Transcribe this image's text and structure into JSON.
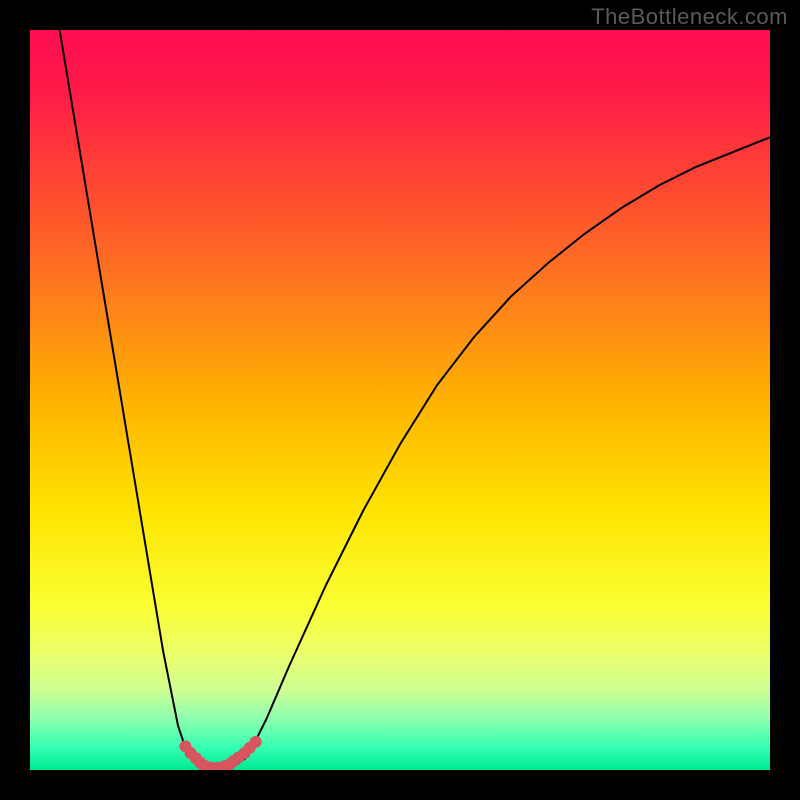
{
  "watermark": "TheBottleneck.com",
  "chart_data": {
    "type": "line",
    "title": "",
    "xlabel": "",
    "ylabel": "",
    "xlim": [
      0,
      100
    ],
    "ylim": [
      0,
      100
    ],
    "series": [
      {
        "name": "left-branch",
        "x": [
          4,
          6,
          8,
          10,
          12,
          14,
          16,
          18,
          20,
          21,
          22,
          23,
          23.5
        ],
        "y": [
          100,
          88,
          76,
          64,
          52,
          40,
          28,
          16,
          6,
          3,
          1.5,
          0.8,
          0.5
        ],
        "color": "#000000",
        "stroke_width": 2
      },
      {
        "name": "right-branch",
        "x": [
          27.5,
          28,
          29,
          30,
          32,
          35,
          40,
          45,
          50,
          55,
          60,
          65,
          70,
          75,
          80,
          85,
          90,
          95,
          100
        ],
        "y": [
          0.5,
          0.8,
          1.5,
          3,
          7,
          14,
          25,
          35,
          44,
          52,
          58.5,
          64,
          68.5,
          72.5,
          76,
          79,
          81.5,
          83.5,
          85.5
        ],
        "color": "#000000",
        "stroke_width": 2
      },
      {
        "name": "dotted-highlight",
        "x": [
          21,
          21.7,
          22.4,
          23,
          23.5,
          24.2,
          25,
          25.5,
          26.3,
          27,
          27.5,
          28.2,
          29,
          29.7,
          30.5
        ],
        "y": [
          3.2,
          2.3,
          1.6,
          1.0,
          0.6,
          0.35,
          0.25,
          0.3,
          0.5,
          0.8,
          1.2,
          1.7,
          2.3,
          3.0,
          3.8
        ],
        "color": "#d8545f",
        "marker": "circle",
        "marker_size": 6
      }
    ],
    "gradient": {
      "stops": [
        {
          "offset": 0,
          "color": "#ff0d52"
        },
        {
          "offset": 8,
          "color": "#ff1a48"
        },
        {
          "offset": 20,
          "color": "#ff4433"
        },
        {
          "offset": 35,
          "color": "#ff7a1f"
        },
        {
          "offset": 50,
          "color": "#ffb200"
        },
        {
          "offset": 65,
          "color": "#ffe400"
        },
        {
          "offset": 78,
          "color": "#f9ff33"
        },
        {
          "offset": 84,
          "color": "#ecff6a"
        },
        {
          "offset": 89,
          "color": "#d0ff90"
        },
        {
          "offset": 93,
          "color": "#8fffb0"
        },
        {
          "offset": 97,
          "color": "#33ffb3"
        },
        {
          "offset": 100,
          "color": "#00e890"
        }
      ]
    },
    "annotations": []
  }
}
